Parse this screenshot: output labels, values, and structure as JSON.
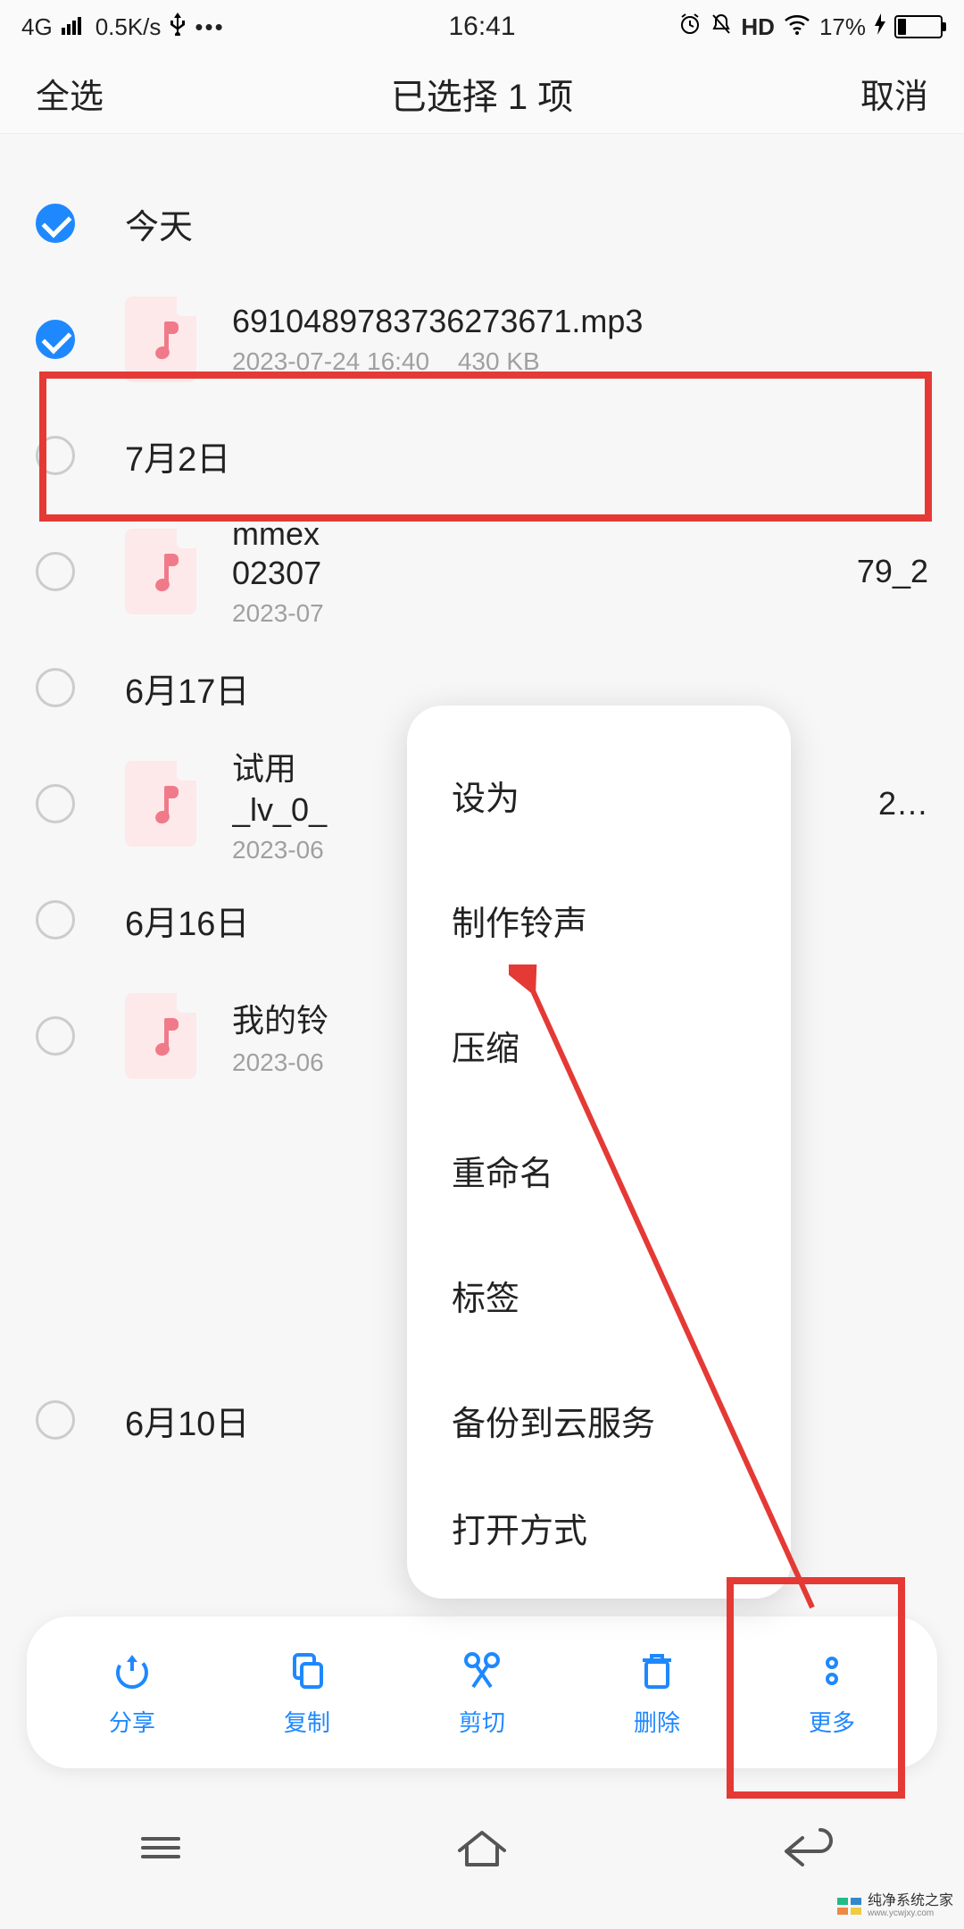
{
  "statusbar": {
    "network": "4G",
    "speed": "0.5K/s",
    "time": "16:41",
    "hd": "HD",
    "battery_pct": "17%"
  },
  "header": {
    "select_all": "全选",
    "title": "已选择 1 项",
    "cancel": "取消"
  },
  "groups": [
    {
      "label": "今天",
      "checked": true
    },
    {
      "label": "7月2日",
      "checked": false
    },
    {
      "label": "6月17日",
      "checked": false
    },
    {
      "label": "6月16日",
      "checked": false
    },
    {
      "label": "6月10日",
      "checked": false
    }
  ],
  "files": [
    {
      "name": "6910489783736273671.mp3",
      "date": "2023-07-24 16:40",
      "size": "430 KB",
      "checked": true,
      "trail": ""
    },
    {
      "name": "mmex",
      "date": "2023-07",
      "size": "",
      "checked": false,
      "trail": "79_2",
      "line2": "02307"
    },
    {
      "name": "试用",
      "date": "2023-06",
      "size": "",
      "checked": false,
      "trail": "2…",
      "line2": "_lv_0_"
    },
    {
      "name": "我的铃",
      "date": "2023-06",
      "size": "",
      "checked": false,
      "trail": ""
    }
  ],
  "popup": {
    "items": [
      "设为",
      "制作铃声",
      "压缩",
      "重命名",
      "标签",
      "备份到云服务",
      "打开方式"
    ]
  },
  "toolbar": {
    "share": "分享",
    "copy": "复制",
    "cut": "剪切",
    "delete": "删除",
    "more": "更多"
  },
  "watermark": {
    "title": "纯净系统之家",
    "url": "www.ycwjxy.com"
  }
}
